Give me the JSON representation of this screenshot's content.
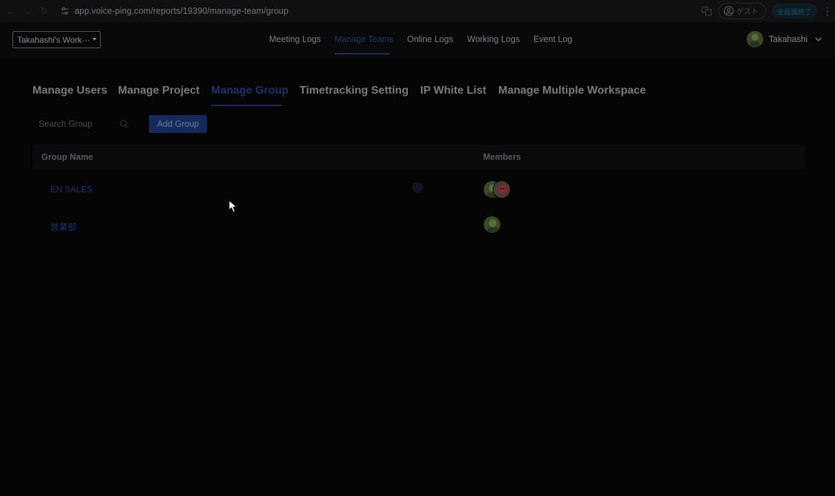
{
  "browser": {
    "url": "app.voice-ping.com/reports/19390/manage-team/group",
    "guest_label": "ゲスト",
    "fullscreen_exit_label": "全画面終了"
  },
  "header": {
    "workspace": "Takahashi's Work···",
    "nav": [
      {
        "label": "Meeting Logs",
        "active": false
      },
      {
        "label": "Manage Teams",
        "active": true
      },
      {
        "label": "Online Logs",
        "active": false
      },
      {
        "label": "Working Logs",
        "active": false
      },
      {
        "label": "Event Log",
        "active": false
      }
    ],
    "user_name": "Takahashi"
  },
  "subtabs": [
    {
      "label": "Manage Users",
      "active": false
    },
    {
      "label": "Manage Project",
      "active": false
    },
    {
      "label": "Manage Group",
      "active": true
    },
    {
      "label": "Timetracking Setting",
      "active": false
    },
    {
      "label": "IP White List",
      "active": false
    },
    {
      "label": "Manage Multiple Workspace",
      "active": false
    }
  ],
  "toolbar": {
    "search_placeholder": "Search Group",
    "add_button": "Add Group"
  },
  "table": {
    "columns": [
      "Group Name",
      "Members"
    ],
    "rows": [
      {
        "name": "EN SALES",
        "members": [
          "green-avatar",
          "red-avatar"
        ]
      },
      {
        "name": "営業部",
        "members": [
          "green-avatar"
        ]
      }
    ]
  },
  "colors": {
    "accent": "#1d3266",
    "background": "#050506"
  }
}
